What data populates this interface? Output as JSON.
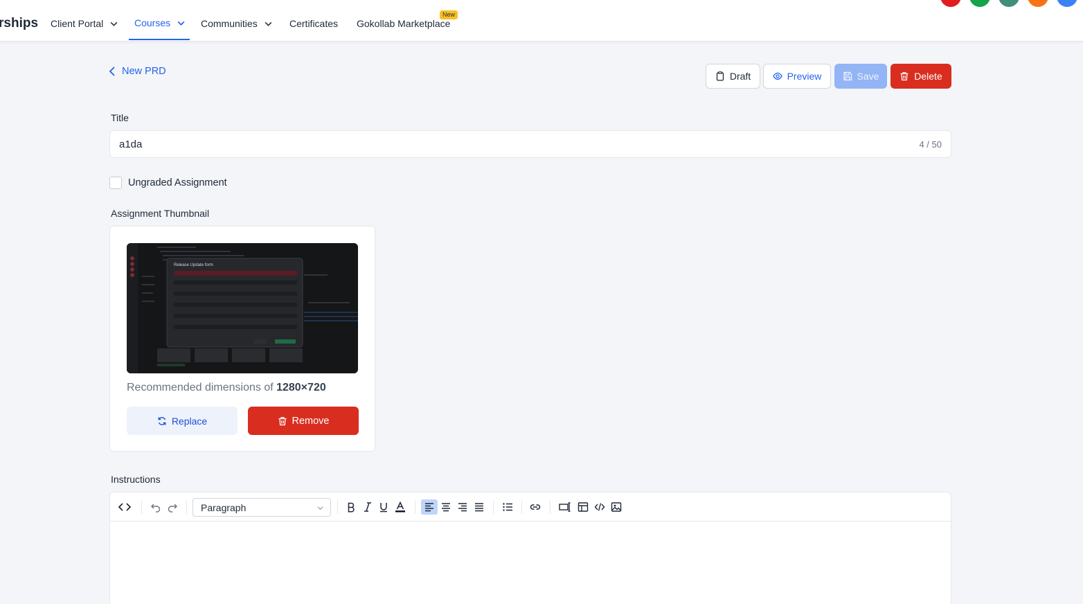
{
  "nav": {
    "brand": "rships",
    "items": [
      {
        "label": "Client Portal"
      },
      {
        "label": "Courses"
      },
      {
        "label": "Communities"
      },
      {
        "label": "Certificates"
      },
      {
        "label": "Gokollab Marketplace"
      }
    ],
    "new_badge": "New",
    "avatar_colors": [
      "#e11d1d",
      "#16a34a",
      "#3f8f7a",
      "#f97316",
      "#3b82f6"
    ]
  },
  "header": {
    "back_label": "New PRD",
    "draft_label": "Draft",
    "preview_label": "Preview",
    "save_label": "Save",
    "delete_label": "Delete"
  },
  "form": {
    "title_label": "Title",
    "title_value": "a1da",
    "title_count": "4 / 50",
    "ungraded_label": "Ungraded Assignment",
    "ungraded_checked": false,
    "thumbnail_label": "Assignment Thumbnail",
    "recommended_prefix": "Recommended dimensions of ",
    "recommended_value": "1280×720",
    "replace_label": "Replace",
    "remove_label": "Remove",
    "instructions_label": "Instructions"
  },
  "editor": {
    "block_format": "Paragraph"
  },
  "colors": {
    "primary": "#2563eb",
    "danger": "#d92d20",
    "save_disabled": "#93b4f5"
  }
}
